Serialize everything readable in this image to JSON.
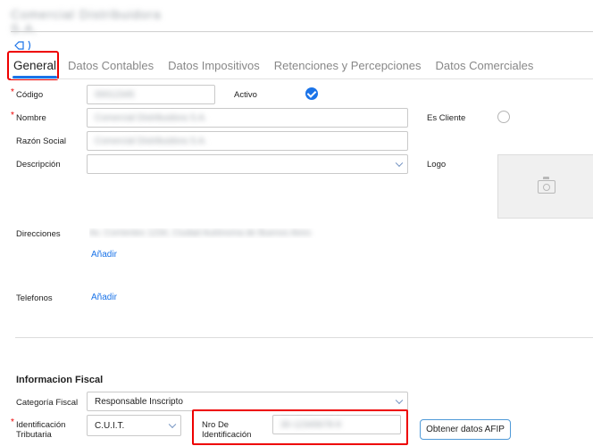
{
  "header": {
    "entity_name": "Comercial Distribuidora S.A."
  },
  "tabs": [
    {
      "label": "General"
    },
    {
      "label": "Datos Contables"
    },
    {
      "label": "Datos Impositivos"
    },
    {
      "label": "Retenciones y Percepciones"
    },
    {
      "label": "Datos Comerciales"
    }
  ],
  "form": {
    "codigo": {
      "label": "Código",
      "value": "00012345"
    },
    "activo": {
      "label": "Activo",
      "checked": true
    },
    "nombre": {
      "label": "Nombre",
      "value": "Comercial Distribuidora S.A."
    },
    "es_cliente": {
      "label": "Es Cliente",
      "checked": false
    },
    "razon_social": {
      "label": "Razón Social",
      "value": "Comercial Distribuidora S.A."
    },
    "descripcion": {
      "label": "Descripción",
      "value": ""
    },
    "logo": {
      "label": "Logo"
    },
    "direcciones": {
      "label": "Direcciones",
      "value": "Av. Corrientes 1234, Ciudad Autónoma de Buenos Aires",
      "add_label": "Añadir"
    },
    "telefonos": {
      "label": "Telefonos",
      "add_label": "Añadir"
    }
  },
  "fiscal": {
    "title": "Informacion Fiscal",
    "categoria": {
      "label": "Categoría Fiscal",
      "value": "Responsable Inscripto"
    },
    "identificacion": {
      "label_line1": "Identificación",
      "label_line2": "Tributaria",
      "value": "C.U.I.T."
    },
    "nro": {
      "label_line1": "Nro De",
      "label_line2": "Identificación",
      "value": "30-12345678-9"
    },
    "afip_button": "Obtener datos AFIP"
  },
  "colors": {
    "accent": "#1a73e8",
    "highlight": "#e00000"
  },
  "icons": {
    "tag": "tag-icon",
    "check": "check-icon",
    "camera": "camera-icon",
    "chevron": "chevron-down-icon"
  }
}
